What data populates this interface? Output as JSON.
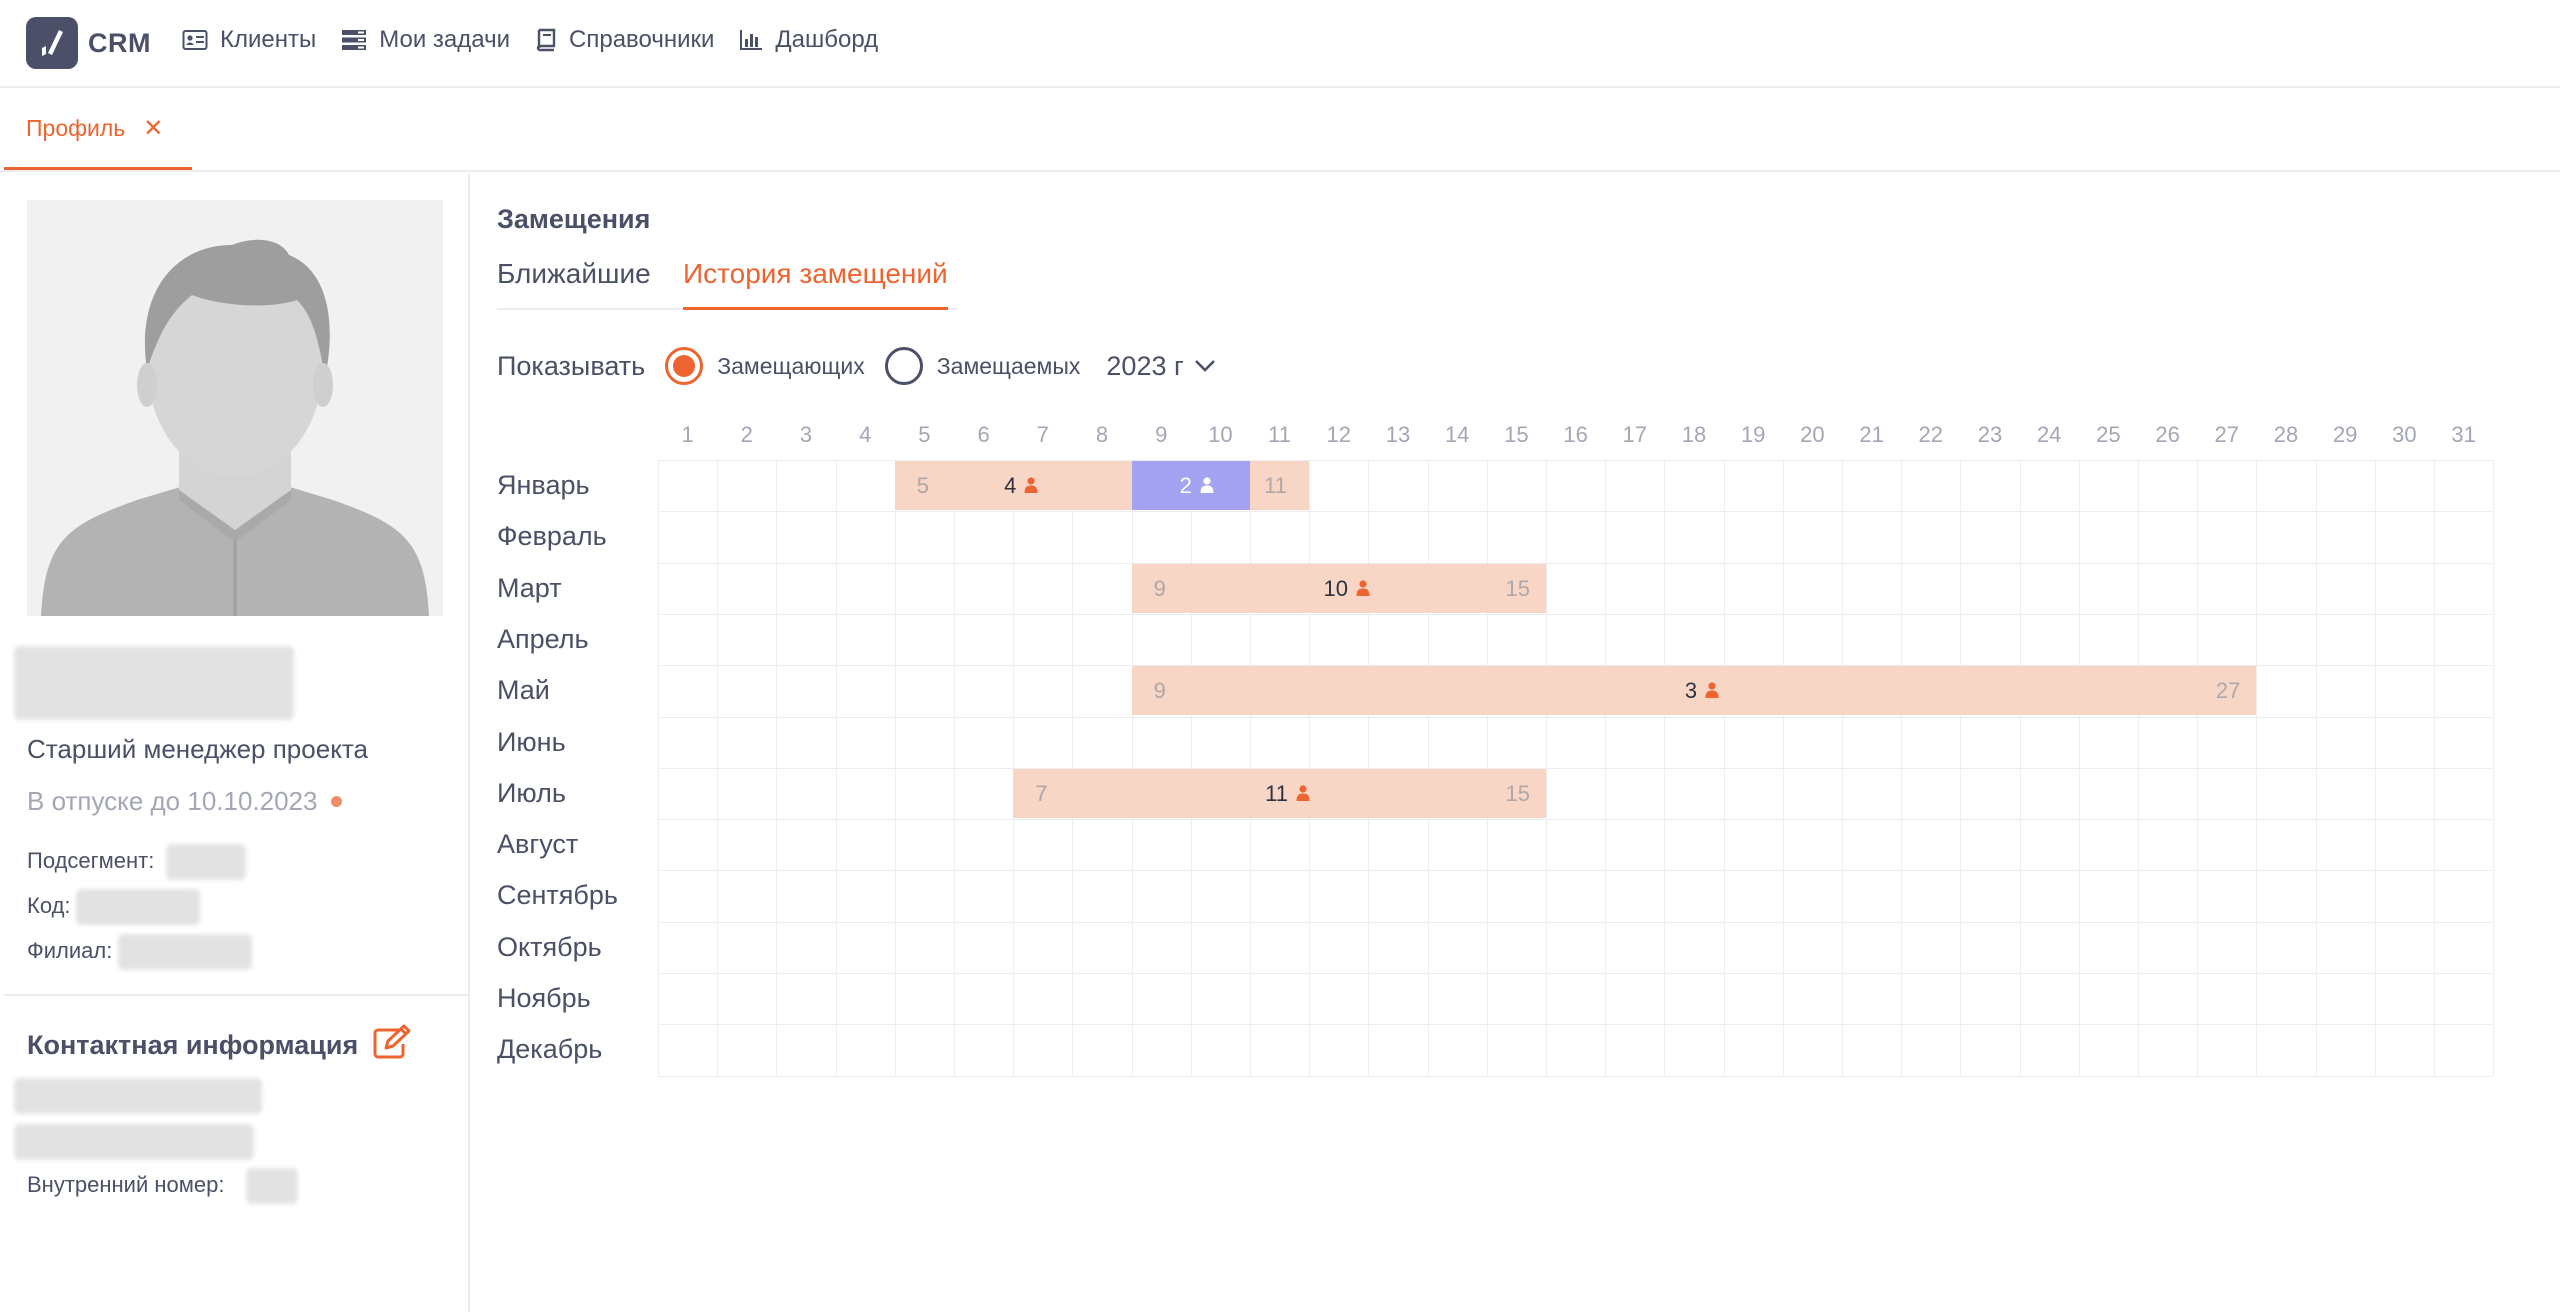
{
  "app": {
    "logo_text": "CRM"
  },
  "nav": [
    {
      "label": "Клиенты",
      "icon": "contacts-card-icon"
    },
    {
      "label": "Мои задачи",
      "icon": "tasks-list-icon"
    },
    {
      "label": "Справочники",
      "icon": "book-icon"
    },
    {
      "label": "Дашборд",
      "icon": "bar-chart-icon"
    }
  ],
  "tabs": {
    "profile_label": "Профиль",
    "close_glyph": "✕"
  },
  "profile": {
    "job_title": "Старший менеджер проекта",
    "vacation_status": "В отпуске до 10.10.2023",
    "subsegment_label": "Подсегмент:",
    "code_label": "Код:",
    "branch_label": "Филиал:"
  },
  "contacts": {
    "title": "Контактная информация",
    "internal_number_label": "Внутренний номер:"
  },
  "substitutions": {
    "title": "Замещения",
    "tabs": [
      "Ближайшие",
      "История замещений"
    ],
    "active_tab": "История замещений",
    "show_label": "Показывать",
    "radio_options": [
      "Замещающих",
      "Замещаемых"
    ],
    "selected_radio": "Замещающих",
    "year_label": "2023 г"
  },
  "calendar": {
    "days": [
      "1",
      "2",
      "3",
      "4",
      "5",
      "6",
      "7",
      "8",
      "9",
      "10",
      "11",
      "12",
      "13",
      "14",
      "15",
      "16",
      "17",
      "18",
      "19",
      "20",
      "21",
      "22",
      "23",
      "24",
      "25",
      "26",
      "27",
      "28",
      "29",
      "30",
      "31"
    ],
    "months": [
      "Январь",
      "Февраль",
      "Март",
      "Апрель",
      "Май",
      "Июнь",
      "Июль",
      "Август",
      "Сентябрь",
      "Октябрь",
      "Ноябрь",
      "Декабрь"
    ],
    "periods": [
      {
        "month": "Январь",
        "start": 5,
        "end": 8,
        "start_label": "5",
        "count": "4",
        "style": "peach"
      },
      {
        "month": "Январь",
        "start": 9,
        "end": 10,
        "start_label": "",
        "count": "2",
        "style": "blue"
      },
      {
        "month": "Январь",
        "start": 11,
        "end": 11,
        "start_label": "11",
        "count": "",
        "style": "peach"
      },
      {
        "month": "Март",
        "start": 9,
        "end": 15,
        "start_label": "9",
        "count": "10",
        "end_label": "15",
        "style": "peach"
      },
      {
        "month": "Май",
        "start": 9,
        "end": 27,
        "start_label": "9",
        "count": "3",
        "end_label": "27",
        "style": "peach"
      },
      {
        "month": "Июль",
        "start": 7,
        "end": 15,
        "start_label": "7",
        "count": "11",
        "end_label": "15",
        "style": "peach"
      }
    ]
  },
  "colors": {
    "accent": "#ee6430",
    "peach": "#f8d6c6",
    "blue": "#a3a3f2",
    "text": "#4a5066",
    "muted": "#a3a7b5"
  }
}
